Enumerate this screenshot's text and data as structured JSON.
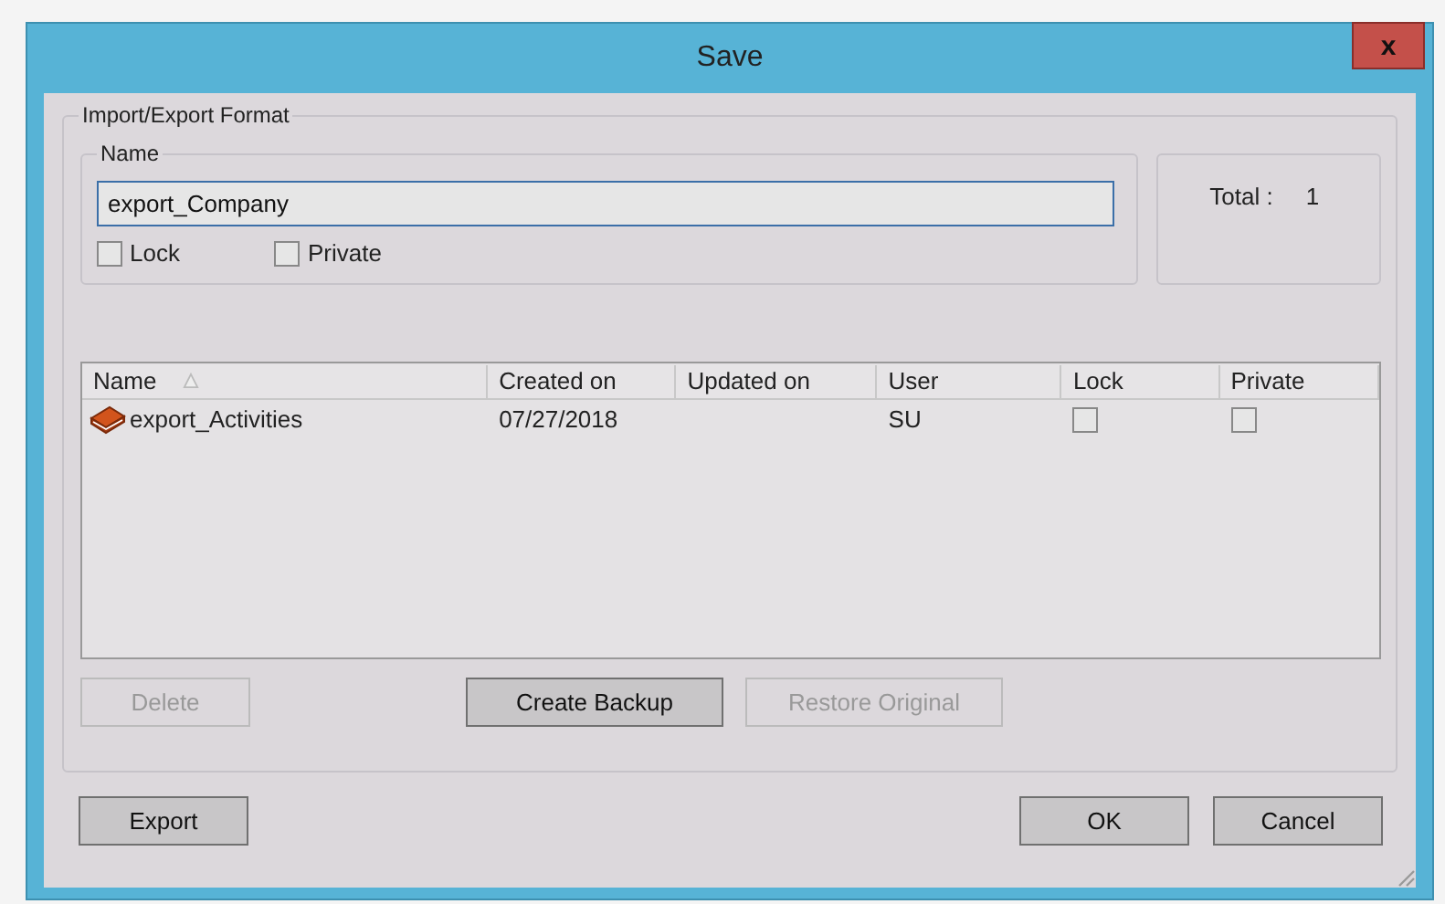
{
  "window": {
    "title": "Save",
    "close": "x"
  },
  "format_group": {
    "legend": "Import/Export Format",
    "name_group": {
      "legend": "Name",
      "value": "export_Company",
      "checkboxes": [
        {
          "label": "Lock",
          "checked": false
        },
        {
          "label": "Private",
          "checked": false
        }
      ]
    },
    "total": {
      "label": "Total :",
      "value": "1"
    },
    "table": {
      "columns": [
        {
          "label": "Name",
          "sorted": true
        },
        {
          "label": "Created on",
          "sorted": false
        },
        {
          "label": "Updated on",
          "sorted": false
        },
        {
          "label": "User",
          "sorted": false
        },
        {
          "label": "Lock",
          "sorted": false
        },
        {
          "label": "Private",
          "sorted": false
        }
      ],
      "rows": [
        {
          "name": "export_Activities",
          "created_on": "07/27/2018",
          "user": "SU",
          "lock": false,
          "private": false,
          "selected": false
        }
      ]
    },
    "actions": [
      {
        "label": "Delete",
        "disabled": true
      },
      {
        "label": "Create Backup",
        "disabled": false
      },
      {
        "label": "Restore Original",
        "disabled": true
      }
    ]
  },
  "footer_left": [
    {
      "label": "Export",
      "disabled": false
    }
  ],
  "footer_right": [
    {
      "label": "OK",
      "disabled": false
    },
    {
      "label": "Cancel",
      "disabled": false
    }
  ]
}
